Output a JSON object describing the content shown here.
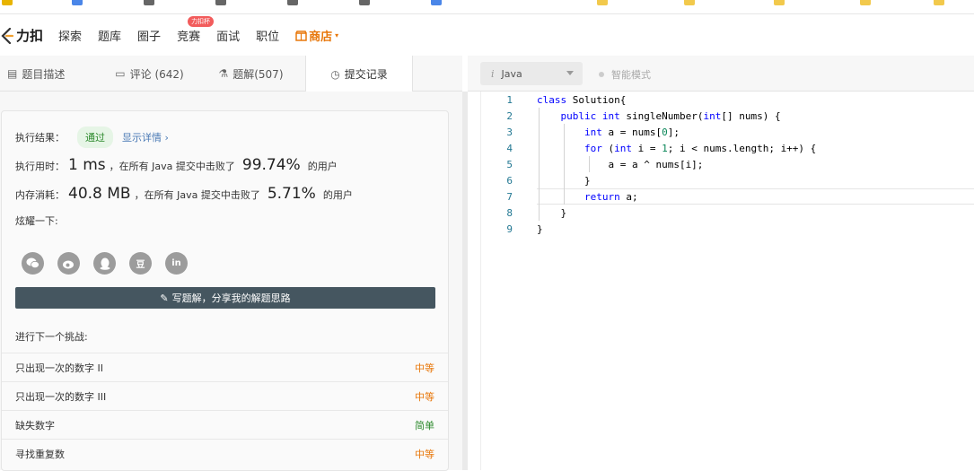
{
  "navbar": {
    "logo_text": "力扣",
    "items": [
      {
        "label": "探索"
      },
      {
        "label": "题库"
      },
      {
        "label": "圈子"
      },
      {
        "label": "竞赛",
        "badge": "力扣杯"
      },
      {
        "label": "面试"
      },
      {
        "label": "职位"
      }
    ],
    "shop_label": "商店",
    "accent_color": "#e8780c"
  },
  "tabs": [
    {
      "label": "题目描述",
      "icon": "description-icon"
    },
    {
      "label": "评论 (642)",
      "icon": "comment-icon"
    },
    {
      "label": "题解(507)",
      "icon": "flask-icon"
    },
    {
      "label": "提交记录",
      "icon": "clock-icon"
    }
  ],
  "result": {
    "label": "执行结果：",
    "status": "通过",
    "detail_link": "显示详情 ›",
    "time_label": "执行用时：",
    "time_value": "1 ms",
    "time_mid": "，在所有 Java 提交中击败了",
    "time_pct": "99.74%",
    "time_suffix": "的用户",
    "mem_label": "内存消耗：",
    "mem_value": "40.8 MB",
    "mem_mid": "，在所有 Java 提交中击败了",
    "mem_pct": "5.71%",
    "mem_suffix": "的用户",
    "share_label": "炫耀一下:",
    "share_icons": [
      "wechat-icon",
      "weibo-icon",
      "qq-icon",
      "douban-icon",
      "linkedin-icon"
    ],
    "douban_glyph": "豆",
    "linkedin_glyph": "in"
  },
  "write_button": "写题解，分享我的解题思路",
  "next_challenge_label": "进行下一个挑战:",
  "problems": [
    {
      "title": "只出现一次的数字 II",
      "difficulty": "中等",
      "level": "mid"
    },
    {
      "title": "只出现一次的数字 III",
      "difficulty": "中等",
      "level": "mid"
    },
    {
      "title": "缺失数字",
      "difficulty": "简单",
      "level": "easy"
    },
    {
      "title": "寻找重复数",
      "difficulty": "中等",
      "level": "mid"
    }
  ],
  "editor": {
    "language": "Java",
    "smart_mode": "智能模式",
    "line_numbers": [
      "1",
      "2",
      "3",
      "4",
      "5",
      "6",
      "7",
      "8",
      "9"
    ]
  }
}
